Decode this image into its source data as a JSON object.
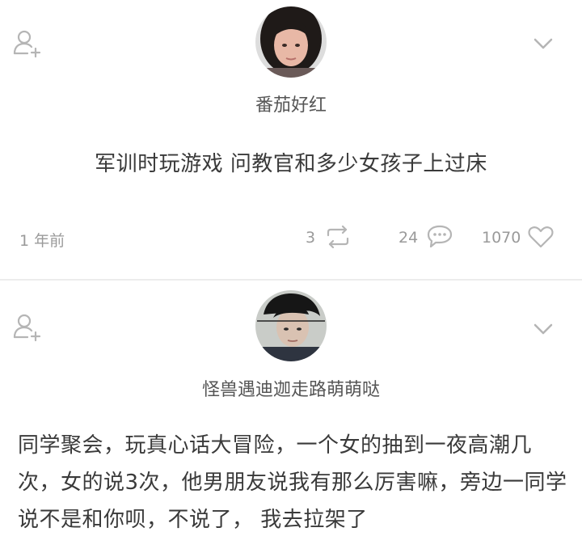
{
  "posts": [
    {
      "username": "番茄好红",
      "text": "军训时玩游戏 问教官和多少女孩子上过床",
      "time": "1 年前",
      "reposts": "3",
      "comments": "24",
      "likes": "1070"
    },
    {
      "username": "怪兽遇迪迦走路萌萌哒",
      "text": "同学聚会，玩真心话大冒险，一个女的抽到一夜高潮几次，女的说3次，他男朋友说我有那么厉害嘛，旁边一同学说不是和你呗，不说了，  我去拉架了"
    }
  ],
  "icons": {
    "follow": "add-user-icon",
    "menu": "chevron-down-icon",
    "repost": "repost-icon",
    "comment": "comment-icon",
    "like": "heart-icon"
  },
  "colors": {
    "icon_gray": "#b5b5b5",
    "text_dark": "#3a3a3a",
    "text_muted": "#9a9a9a"
  }
}
